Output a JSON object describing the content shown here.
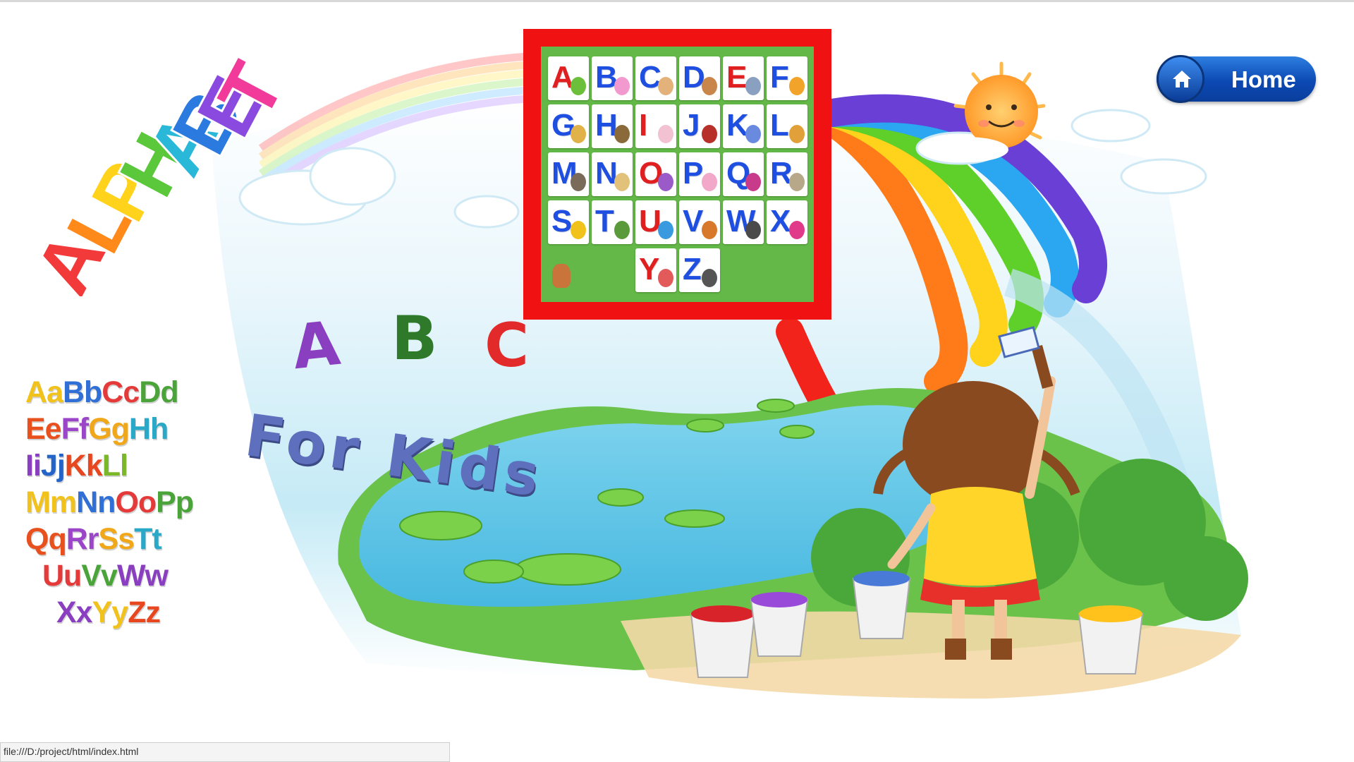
{
  "home_button": {
    "label": "Home",
    "icon": "home-icon"
  },
  "status_bar": {
    "url": "file:///D:/project/html/index.html"
  },
  "logo": {
    "text": "ALPHABET"
  },
  "abc_title": {
    "letters": [
      "A",
      "B",
      "C"
    ],
    "subtitle": "For Kids"
  },
  "alphabet_pairs": [
    [
      {
        "t": "Aa",
        "c": "#f2c21c"
      },
      {
        "t": "Bb",
        "c": "#2f6fd6"
      },
      {
        "t": "Cc",
        "c": "#e43a3a"
      },
      {
        "t": "Dd",
        "c": "#4aa43a"
      }
    ],
    [
      {
        "t": "Ee",
        "c": "#e8501e"
      },
      {
        "t": "Ff",
        "c": "#9b45c8"
      },
      {
        "t": "Gg",
        "c": "#f0a81a"
      },
      {
        "t": "Hh",
        "c": "#2aa8c8"
      }
    ],
    [
      {
        "t": "Ii",
        "c": "#8a3fc0"
      },
      {
        "t": "Jj",
        "c": "#2464c8"
      },
      {
        "t": "Kk",
        "c": "#e8461e"
      },
      {
        "t": "Ll",
        "c": "#7ab82a"
      }
    ],
    [
      {
        "t": "Mm",
        "c": "#f2c21c"
      },
      {
        "t": "Nn",
        "c": "#2f6fd6"
      },
      {
        "t": "Oo",
        "c": "#e43a3a"
      },
      {
        "t": "Pp",
        "c": "#4aa43a"
      }
    ],
    [
      {
        "t": "Qq",
        "c": "#e8501e"
      },
      {
        "t": "Rr",
        "c": "#9b45c8"
      },
      {
        "t": "Ss",
        "c": "#f0a81a"
      },
      {
        "t": "Tt",
        "c": "#2aa8c8"
      }
    ],
    [
      {
        "t": "Uu",
        "c": "#e43a3a"
      },
      {
        "t": "Vv",
        "c": "#4aa43a"
      },
      {
        "t": "Ww",
        "c": "#8a3fc0"
      }
    ],
    [
      {
        "t": "Xx",
        "c": "#8a3fc0"
      },
      {
        "t": "Yy",
        "c": "#f2c21c"
      },
      {
        "t": "Zz",
        "c": "#e8461e"
      }
    ]
  ],
  "letter_tiles": [
    {
      "letter": "A",
      "color": "#e02020",
      "picture": "apple",
      "pic_color": "#6bbf3a"
    },
    {
      "letter": "B",
      "color": "#1f4fe0",
      "picture": "ball",
      "pic_color": "#f29ad0"
    },
    {
      "letter": "C",
      "color": "#1f4fe0",
      "picture": "cat",
      "pic_color": "#e3b27a"
    },
    {
      "letter": "D",
      "color": "#1f4fe0",
      "picture": "dog",
      "pic_color": "#c8864a"
    },
    {
      "letter": "E",
      "color": "#e02020",
      "picture": "elephant",
      "pic_color": "#8aa0c0"
    },
    {
      "letter": "F",
      "color": "#1f4fe0",
      "picture": "fish",
      "pic_color": "#f2a32a"
    },
    {
      "letter": "G",
      "color": "#1f4fe0",
      "picture": "giraffe",
      "pic_color": "#e2b24a"
    },
    {
      "letter": "H",
      "color": "#1f4fe0",
      "picture": "hat",
      "pic_color": "#8a6a3a"
    },
    {
      "letter": "I",
      "color": "#e02020",
      "picture": "ice-cream",
      "pic_color": "#f2c2d2"
    },
    {
      "letter": "J",
      "color": "#1f4fe0",
      "picture": "jam",
      "pic_color": "#b8302a"
    },
    {
      "letter": "K",
      "color": "#1f4fe0",
      "picture": "kite",
      "pic_color": "#6a8ae0"
    },
    {
      "letter": "L",
      "color": "#1f4fe0",
      "picture": "lion",
      "pic_color": "#e2a03a"
    },
    {
      "letter": "M",
      "color": "#1f4fe0",
      "picture": "monkey",
      "pic_color": "#7a6a5a"
    },
    {
      "letter": "N",
      "color": "#1f4fe0",
      "picture": "nest",
      "pic_color": "#e2c27a"
    },
    {
      "letter": "O",
      "color": "#e02020",
      "picture": "octopus",
      "pic_color": "#9a5ac8"
    },
    {
      "letter": "P",
      "color": "#1f4fe0",
      "picture": "pig",
      "pic_color": "#f2a8c8"
    },
    {
      "letter": "Q",
      "color": "#1f4fe0",
      "picture": "queen",
      "pic_color": "#c83a8a"
    },
    {
      "letter": "R",
      "color": "#1f4fe0",
      "picture": "rabbit",
      "pic_color": "#b8a88a"
    },
    {
      "letter": "S",
      "color": "#1f4fe0",
      "picture": "sun",
      "pic_color": "#f2c21c"
    },
    {
      "letter": "T",
      "color": "#1f4fe0",
      "picture": "turtle",
      "pic_color": "#5a9a3a"
    },
    {
      "letter": "U",
      "color": "#e02020",
      "picture": "umbrella",
      "pic_color": "#3a9ae0"
    },
    {
      "letter": "V",
      "color": "#1f4fe0",
      "picture": "vase",
      "pic_color": "#d8782a"
    },
    {
      "letter": "W",
      "color": "#1f4fe0",
      "picture": "whale",
      "pic_color": "#4a4a4a"
    },
    {
      "letter": "X",
      "color": "#1f4fe0",
      "picture": "xylophone",
      "pic_color": "#e23a8a"
    },
    {
      "letter": "Y",
      "color": "#e02020",
      "picture": "yak",
      "pic_color": "#e25a5a"
    },
    {
      "letter": "Z",
      "color": "#1f4fe0",
      "picture": "zebra",
      "pic_color": "#555555"
    }
  ],
  "colors": {
    "grid_frame": "#f01212",
    "grid_background": "#63b847",
    "home_button": "#0c49b3"
  }
}
